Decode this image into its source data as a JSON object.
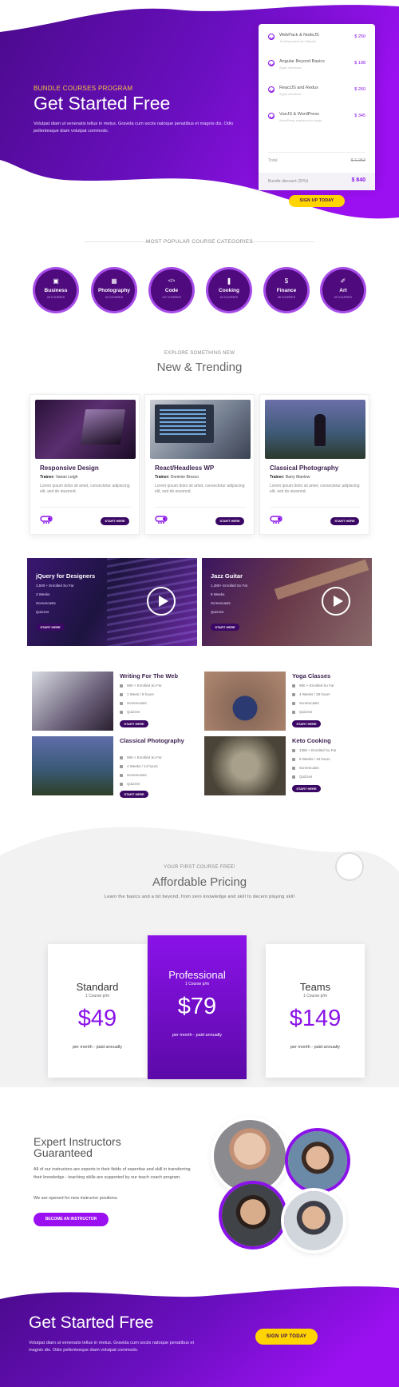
{
  "hero": {
    "eyebrow": "BUNDLE COURSES PROGRAM",
    "title": "Get Started Free",
    "text": "Volutpat diam ut venenatis tellus in metus. Gravida cum sociis natoque penatibus et magnis dis. Odio pellentesque diam volutpat commodo."
  },
  "bundle": {
    "items": [
      {
        "title": "WebPack & NodeJS",
        "sub": "Training asset ad fullyweb",
        "price": "$ 250"
      },
      {
        "title": "Angular Beyond Basics",
        "sub": "Apply checkbox",
        "price": "$ 198"
      },
      {
        "title": "ReactJS and Redux",
        "sub": "Apply checkbox",
        "price": "$ 260"
      },
      {
        "title": "VueJS & WordPress",
        "sub": "WordPress explained in depth",
        "price": "$ 345"
      }
    ],
    "total_label": "Total",
    "total_value": "$ 1,053",
    "discount_label": "Bundle discount (20%)",
    "discount_value": "$ 840",
    "button": "SIGN UP TODAY"
  },
  "categories": {
    "title": "MOST POPULAR COURSE CATEGORIES",
    "items": [
      {
        "name": "Business",
        "count": "28 COURSES",
        "icon": "briefcase-icon"
      },
      {
        "name": "Photography",
        "count": "90 COURSES",
        "icon": "image-icon"
      },
      {
        "name": "Code",
        "count": "122 COURSES",
        "icon": "code-icon"
      },
      {
        "name": "Cooking",
        "count": "60 COURSES",
        "icon": "cutlery-icon"
      },
      {
        "name": "Finance",
        "count": "98 COURSES",
        "icon": "dollar-icon"
      },
      {
        "name": "Art",
        "count": "60 COURSES",
        "icon": "brush-icon"
      }
    ]
  },
  "trending": {
    "eyebrow": "EXPLORE SOMETHING NEW",
    "title": "New & Trending",
    "cards": [
      {
        "title": "Responsive Design",
        "trainer_label": "Trainer:",
        "trainer": "Vanan Leigh",
        "desc": "Lorem ipsum dolor sit amet, consectetur adipiscing elit, sed do eiusmod.",
        "button": "START HERE"
      },
      {
        "title": "React/Headless WP",
        "trainer_label": "Trainer:",
        "trainer": "Dominie Brosco",
        "desc": "Lorem ipsum dolor sit amet, consectetur adipiscing elit, sed do eiusmod.",
        "button": "START HERE"
      },
      {
        "title": "Classical Photography",
        "trainer_label": "Trainer:",
        "trainer": "Barry Manlow",
        "desc": "Lorem ipsum dolor sit amet, consectetur adipiscing elit, sed do eiusmod.",
        "button": "START HERE"
      }
    ],
    "videos": [
      {
        "title": "jQuery for Designers",
        "meta": [
          "2,500 + Enrolled So Far",
          "3 Weeks",
          "Screencasts",
          "Quizzes"
        ],
        "button": "START HERE"
      },
      {
        "title": "Jazz Guitar",
        "meta": [
          "1,380+ Enrolled So Far",
          "8 Weeks",
          "Screencasts",
          "Quizzes"
        ],
        "button": "START HERE"
      }
    ],
    "list": [
      {
        "title": "Writing For The Web",
        "meta": [
          "980 + Enrolled So Far",
          "1 Week / 8 hours",
          "Screencasts",
          "Quizzes"
        ],
        "button": "START HERE"
      },
      {
        "title": "Yoga Classes",
        "meta": [
          "980 + Enrolled So Far",
          "4 Weeks / 28 hours",
          "Screencasts",
          "Quizzes"
        ],
        "button": "START HERE"
      },
      {
        "title": "Classical Photography",
        "meta": [
          "980 + Enrolled So Far",
          "4 Weeks / 14 hours",
          "Screencasts",
          "Quizzes"
        ],
        "button": "START HERE"
      },
      {
        "title": "Keto Cooking",
        "meta": [
          "1380 + Enrolled So Far",
          "8 Weeks / 18 hours",
          "Screencasts",
          "Quizzes"
        ],
        "button": "START HERE"
      }
    ]
  },
  "pricing": {
    "eyebrow": "YOUR FIRST COURSE FREE!",
    "title": "Affordable Pricing",
    "subtitle": "Learn the basics and a bit beyond, from zero knowledge and skill to decent playing skill",
    "plans": [
      {
        "name": "Standard",
        "sub": "1 Course p/m",
        "price": "$49",
        "note": "per month - paid annually"
      },
      {
        "name": "Professional",
        "sub": "1 Course p/m",
        "price": "$79",
        "note": "per month - paid annually"
      },
      {
        "name": "Teams",
        "sub": "1 Course p/m",
        "price": "$149",
        "note": "per month - paid annually"
      }
    ]
  },
  "instructors": {
    "title": "Expert Instructors Guaranteed",
    "p1": "All of our instructors are experts in their fields of expertise and skill in transferring their knowledge - teaching skills are supported by our teach coach program.",
    "p2": "We are opened for new instructor positions.",
    "button": "BECOME AN INSTRUCTOR"
  },
  "footer": {
    "title": "Get Started Free",
    "text": "Volutpat diam ut venenatis tellus in metus. Gravida cum sociis natoque penatibus et magnis dis. Odio pellentesque diam volutpat commodo.",
    "button": "SIGN UP TODAY"
  },
  "colors": {
    "purple": "#8a12e8",
    "deep_purple": "#4b0a8c",
    "yellow": "#ffd400"
  }
}
